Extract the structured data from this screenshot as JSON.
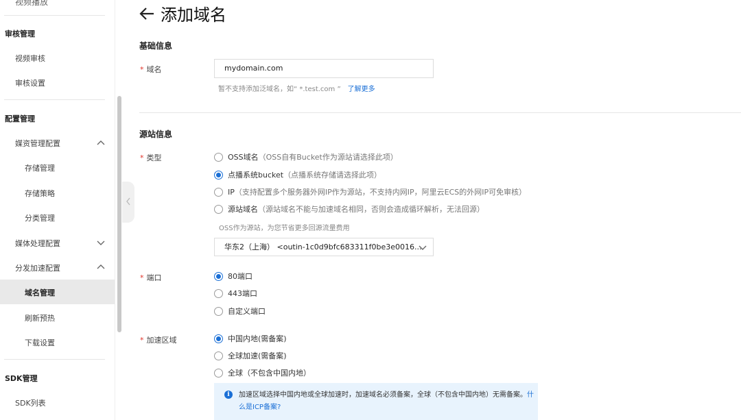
{
  "sidebar": {
    "cut_item": "视频播放",
    "groups": [
      {
        "label": "审核管理"
      },
      {
        "label": "配置管理"
      },
      {
        "label": "SDK管理"
      }
    ],
    "items": {
      "video_audit": "视频审核",
      "audit_settings": "审核设置",
      "media_config": "媒资管理配置",
      "storage_mgmt": "存储管理",
      "storage_policy": "存储策略",
      "category_mgmt": "分类管理",
      "media_processing": "媒体处理配置",
      "cdn_config": "分发加速配置",
      "domain_mgmt": "域名管理",
      "refresh_preheat": "刷新预热",
      "download_settings": "下载设置",
      "sdk_list": "SDK列表"
    }
  },
  "page": {
    "title": "添加域名"
  },
  "basic": {
    "section_title": "基础信息",
    "domain_label": "域名",
    "domain_value": "mydomain.com",
    "help_text": "暂不支持添加泛域名，如“ *.test.com ”",
    "help_link": "了解更多"
  },
  "origin": {
    "section_title": "源站信息",
    "type_label": "类型",
    "types": [
      {
        "label": "OSS域名",
        "desc": "（OSS自有Bucket作为源站请选择此项）",
        "checked": false
      },
      {
        "label": "点播系统bucket",
        "desc": "（点播系统存储请选择此项）",
        "checked": true
      },
      {
        "label": "IP",
        "desc": "（支持配置多个服务器外网IP作为源站，不支持内网IP，阿里云ECS的外网IP可免审核）",
        "checked": false
      },
      {
        "label": "源站域名",
        "desc": "（源站域名不能与加速域名相同，否则会造成循环解析，无法回源）",
        "checked": false
      }
    ],
    "sub_note": "OSS作为源站，为您节省更多回源流量费用",
    "select_value": "华东2（上海） <outin-1c0d9bfc683311f0be3e0016...",
    "port_label": "端口",
    "ports": [
      {
        "label": "80端口",
        "checked": true
      },
      {
        "label": "443端口",
        "checked": false
      },
      {
        "label": "自定义端口",
        "checked": false
      }
    ],
    "region_label": "加速区域",
    "regions": [
      {
        "label": "中国内地(需备案)",
        "checked": true
      },
      {
        "label": "全球加速(需备案)",
        "checked": false
      },
      {
        "label": "全球（不包含中国内地）",
        "checked": false
      }
    ],
    "info_text": "加速区域选择中国内地或全球加速时，加速域名必须备案，全球（不包含中国内地）无需备案。",
    "info_link": "什么是ICP备案?"
  },
  "colors": {
    "accent": "#1a6fd6",
    "required": "#e0342a",
    "info_bg": "#e8f3fd"
  }
}
